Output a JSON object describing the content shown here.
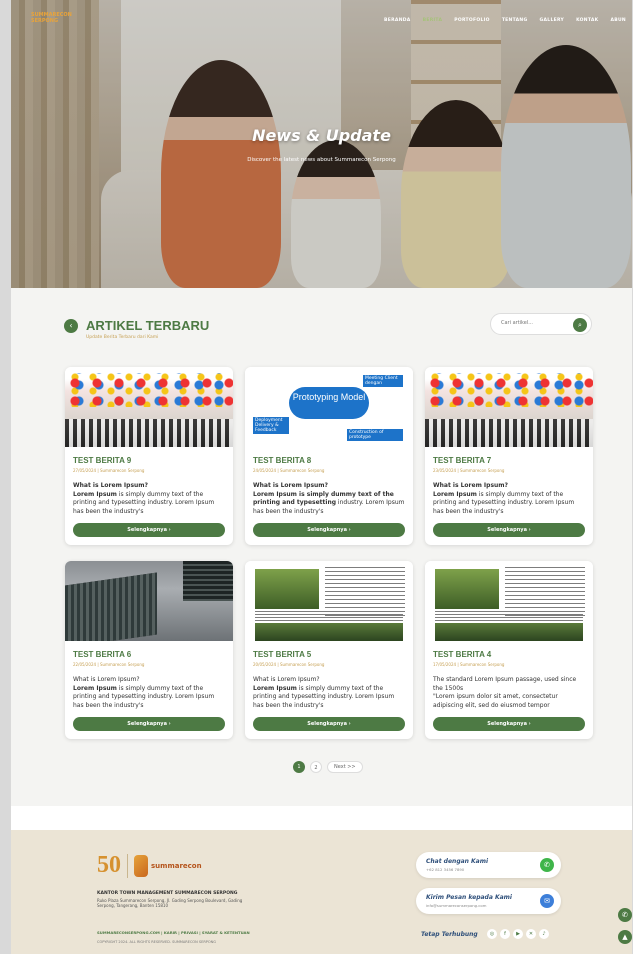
{
  "header": {
    "logo_text": "SUMMARECON SERPONG",
    "nav": [
      "BERANDA",
      "BERITA",
      "PORTOFOLIO",
      "TENTANG",
      "GALLERY",
      "KONTAK",
      "ABUN"
    ]
  },
  "hero": {
    "title": "News & Update",
    "subtitle": "Discover the latest news about Summarecon Serpong"
  },
  "section": {
    "title": "ARTIKEL TERBARU",
    "subtitle": "Update Berita Terbaru dari Kami",
    "search_placeholder": "Cari artikel..."
  },
  "cards": [
    {
      "title": "TEST BERITA 9",
      "meta": "27/05/2024 | Summarecon Serpong",
      "text_bold": "What is Lorem Ipsum?",
      "text_b2": "Lorem Ipsum",
      "text": " is simply dummy text of the printing and typesetting industry. Lorem Ipsum has been the industry's",
      "more": "Selengkapnya  ›"
    },
    {
      "title": "TEST BERITA 8",
      "meta": "24/05/2024 | Summarecon Serpong",
      "text_bold": "What is Lorem Ipsum?",
      "text_b2": "Lorem Ipsum is simply dummy text of the printing and typesetting",
      "text": " industry. Lorem Ipsum has been the industry's",
      "more": "Selengkapnya  ›"
    },
    {
      "title": "TEST BERITA 7",
      "meta": "23/05/2024 | Summarecon Serpong",
      "text_bold": "What is Lorem Ipsum?",
      "text_b2": "Lorem Ipsum",
      "text": " is simply dummy text of the printing and typesetting industry. Lorem Ipsum has been the industry's",
      "more": "Selengkapnya  ›"
    },
    {
      "title": "TEST BERITA 6",
      "meta": "22/05/2024 | Summarecon Serpong",
      "text_bold": "What is Lorem Ipsum?",
      "text_b2": "Lorem Ipsum",
      "text": " is simply dummy text of the printing and typesetting industry. Lorem Ipsum has been the industry's",
      "more": "Selengkapnya  ›"
    },
    {
      "title": "TEST BERITA 5",
      "meta": "20/05/2024 | Summarecon Serpong",
      "text_bold": "What is Lorem Ipsum?",
      "text_b2": "Lorem Ipsum",
      "text": " is simply dummy text of the printing and typesetting industry. Lorem Ipsum has been the industry's",
      "more": "Selengkapnya  ›"
    },
    {
      "title": "TEST BERITA 4",
      "meta": "17/05/2024 | Summarecon Serpong",
      "text_bold": "The standard Lorem Ipsum passage, used since the 1500s",
      "text_b2": "",
      "text": "\"Lorem ipsum dolor sit amet, consectetur adipiscing elit, sed do eiusmod tempor",
      "more": "Selengkapnya  ›"
    }
  ],
  "proto": {
    "title": "Prototyping Model",
    "box1": "Meeting Client dengan",
    "box2": "Deployment Delivery & Feedback",
    "box3": "Construction of prototype"
  },
  "pagination": {
    "p1": "1",
    "p2": "2",
    "next": "Next >>"
  },
  "footer": {
    "badge": "50",
    "brand": "summarecon",
    "office": "KANTOR TOWN MANAGEMENT SUMMARECON SERPONG",
    "address": "Ruko Plaza Summarecon Serpong, Jl. Gading Serpong Boulevard, Gading Serpong, Tangerang, Banten 15810",
    "links": "SUMMARECONSERPONG.COM  |  KARIR  |  PRIVASI  |  SYARAT & KETENTUAN",
    "copyright": "COPYRIGHT 2024. ALL RIGHTS RESERVED. SUMMARECON SERPONG",
    "chat_title": "Chat dengan Kami",
    "chat_sub": "+62 812 3456 7890",
    "mail_title": "Kirim Pesan kepada Kami",
    "mail_sub": "info@summareconserpong.com",
    "social_label": "Tetap Terhubung"
  }
}
